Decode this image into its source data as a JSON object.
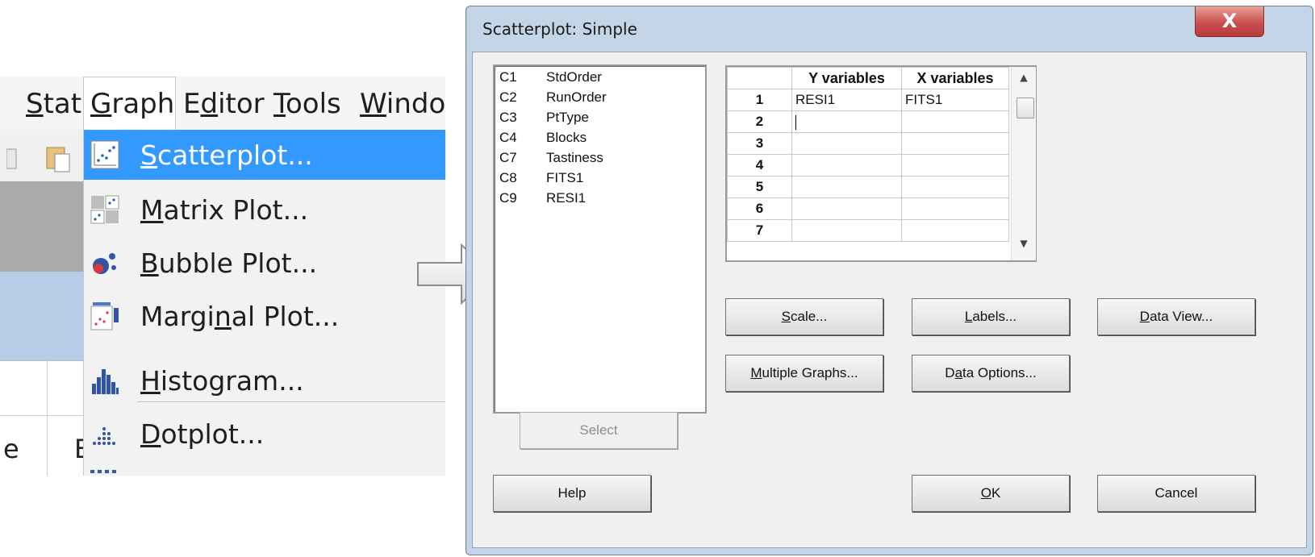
{
  "menubar": {
    "items": [
      {
        "label": "Stat",
        "mnemonic": "S",
        "rest": "tat"
      },
      {
        "label": "Graph",
        "mnemonic": "G",
        "rest": "raph"
      },
      {
        "label": "Editor",
        "pre": "E",
        "mnemonic": "d",
        "rest": "itor"
      },
      {
        "label": "Tools",
        "mnemonic": "T",
        "rest": "ools"
      },
      {
        "label": "Windo",
        "mnemonic": "W",
        "rest": "indo"
      }
    ]
  },
  "graph_menu": {
    "items": [
      {
        "label": "Scatterplot...",
        "pre": "",
        "mnemonic": "S",
        "rest": "catterplot...",
        "icon": "scatterplot-icon",
        "selected": true
      },
      {
        "label": "Matrix Plot...",
        "pre": "",
        "mnemonic": "M",
        "rest": "atrix Plot...",
        "icon": "matrix-plot-icon"
      },
      {
        "label": "Bubble Plot...",
        "pre": "",
        "mnemonic": "B",
        "rest": "ubble Plot...",
        "icon": "bubble-plot-icon"
      },
      {
        "label": "Marginal Plot...",
        "pre": "Margi",
        "mnemonic": "n",
        "rest": "al Plot...",
        "icon": "marginal-plot-icon"
      },
      {
        "label": "Histogram...",
        "pre": "",
        "mnemonic": "H",
        "rest": "istogram...",
        "icon": "histogram-icon"
      },
      {
        "label": "Dotplot...",
        "pre": "",
        "mnemonic": "D",
        "rest": "otplot...",
        "icon": "dotplot-icon"
      }
    ]
  },
  "worksheet_fragment": {
    "left_letter": "e",
    "right_letter": "E"
  },
  "dialog": {
    "title": "Scatterplot: Simple",
    "close_label": "X",
    "columns": [
      {
        "id": "C1",
        "name": "StdOrder"
      },
      {
        "id": "C2",
        "name": "RunOrder"
      },
      {
        "id": "C3",
        "name": "PtType"
      },
      {
        "id": "C4",
        "name": "Blocks"
      },
      {
        "id": "C7",
        "name": "Tastiness"
      },
      {
        "id": "C8",
        "name": "FITS1"
      },
      {
        "id": "C9",
        "name": "RESI1"
      }
    ],
    "grid": {
      "headers": [
        "Y variables",
        "X variables"
      ],
      "rows": [
        {
          "n": "1",
          "y": "RESI1",
          "x": "FITS1"
        },
        {
          "n": "2",
          "y": "",
          "x": ""
        },
        {
          "n": "3",
          "y": "",
          "x": ""
        },
        {
          "n": "4",
          "y": "",
          "x": ""
        },
        {
          "n": "5",
          "y": "",
          "x": ""
        },
        {
          "n": "6",
          "y": "",
          "x": ""
        },
        {
          "n": "7",
          "y": "",
          "x": ""
        }
      ]
    },
    "buttons": {
      "scale": {
        "pre": "",
        "mnemonic": "S",
        "rest": "cale..."
      },
      "labels": {
        "pre": "",
        "mnemonic": "L",
        "rest": "abels..."
      },
      "data_view": {
        "pre": "",
        "mnemonic": "D",
        "rest": "ata View..."
      },
      "multiple_graphs": {
        "pre": "",
        "mnemonic": "M",
        "rest": "ultiple Graphs..."
      },
      "data_options": {
        "pre": "D",
        "mnemonic": "a",
        "rest": "ta Options..."
      },
      "select": {
        "label": "Select"
      },
      "help": {
        "label": "Help"
      },
      "ok": {
        "pre": "",
        "mnemonic": "O",
        "rest": "K"
      },
      "cancel": {
        "label": "Cancel"
      }
    }
  }
}
